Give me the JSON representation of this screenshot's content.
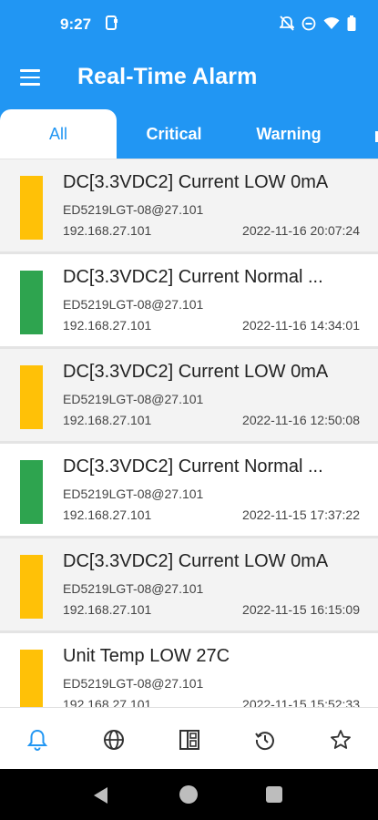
{
  "status_bar": {
    "time": "9:27",
    "icons": [
      "clipboard-notification-icon",
      "bell-off-icon",
      "do-not-disturb-icon",
      "wifi-icon",
      "battery-icon"
    ]
  },
  "app_bar": {
    "title": "Real-Time Alarm",
    "menu_icon": "hamburger-menu-icon"
  },
  "tabs": [
    {
      "label": "All",
      "active": true
    },
    {
      "label": "Critical",
      "active": false
    },
    {
      "label": "Warning",
      "active": false
    }
  ],
  "colors": {
    "primary": "#2196F3",
    "warning": "#FFC107",
    "normal": "#2EA44F"
  },
  "alarms": [
    {
      "message": "DC[3.3VDC2] Current LOW 0mA",
      "device": "ED5219LGT-08@27.101",
      "ip": "192.168.27.101",
      "timestamp": "2022-11-16 20:07:24",
      "severity": "warning",
      "color": "#FFC107"
    },
    {
      "message": "DC[3.3VDC2] Current Normal ...",
      "device": "ED5219LGT-08@27.101",
      "ip": "192.168.27.101",
      "timestamp": "2022-11-16 14:34:01",
      "severity": "normal",
      "color": "#2EA44F"
    },
    {
      "message": "DC[3.3VDC2] Current LOW 0mA",
      "device": "ED5219LGT-08@27.101",
      "ip": "192.168.27.101",
      "timestamp": "2022-11-16 12:50:08",
      "severity": "warning",
      "color": "#FFC107"
    },
    {
      "message": "DC[3.3VDC2] Current Normal ...",
      "device": "ED5219LGT-08@27.101",
      "ip": "192.168.27.101",
      "timestamp": "2022-11-15 17:37:22",
      "severity": "normal",
      "color": "#2EA44F"
    },
    {
      "message": "DC[3.3VDC2] Current LOW 0mA",
      "device": "ED5219LGT-08@27.101",
      "ip": "192.168.27.101",
      "timestamp": "2022-11-15 16:15:09",
      "severity": "warning",
      "color": "#FFC107"
    },
    {
      "message": "Unit Temp LOW 27C",
      "device": "ED5219LGT-08@27.101",
      "ip": "192.168.27.101",
      "timestamp": "2022-11-15 15:52:33",
      "severity": "warning",
      "color": "#FFC107"
    }
  ],
  "bottom_nav": [
    {
      "icon": "bell-icon",
      "active": true
    },
    {
      "icon": "globe-icon",
      "active": false
    },
    {
      "icon": "dashboard-icon",
      "active": false
    },
    {
      "icon": "history-icon",
      "active": false
    },
    {
      "icon": "star-icon",
      "active": false
    }
  ],
  "system_nav": [
    "back-icon",
    "home-icon",
    "recents-icon"
  ]
}
